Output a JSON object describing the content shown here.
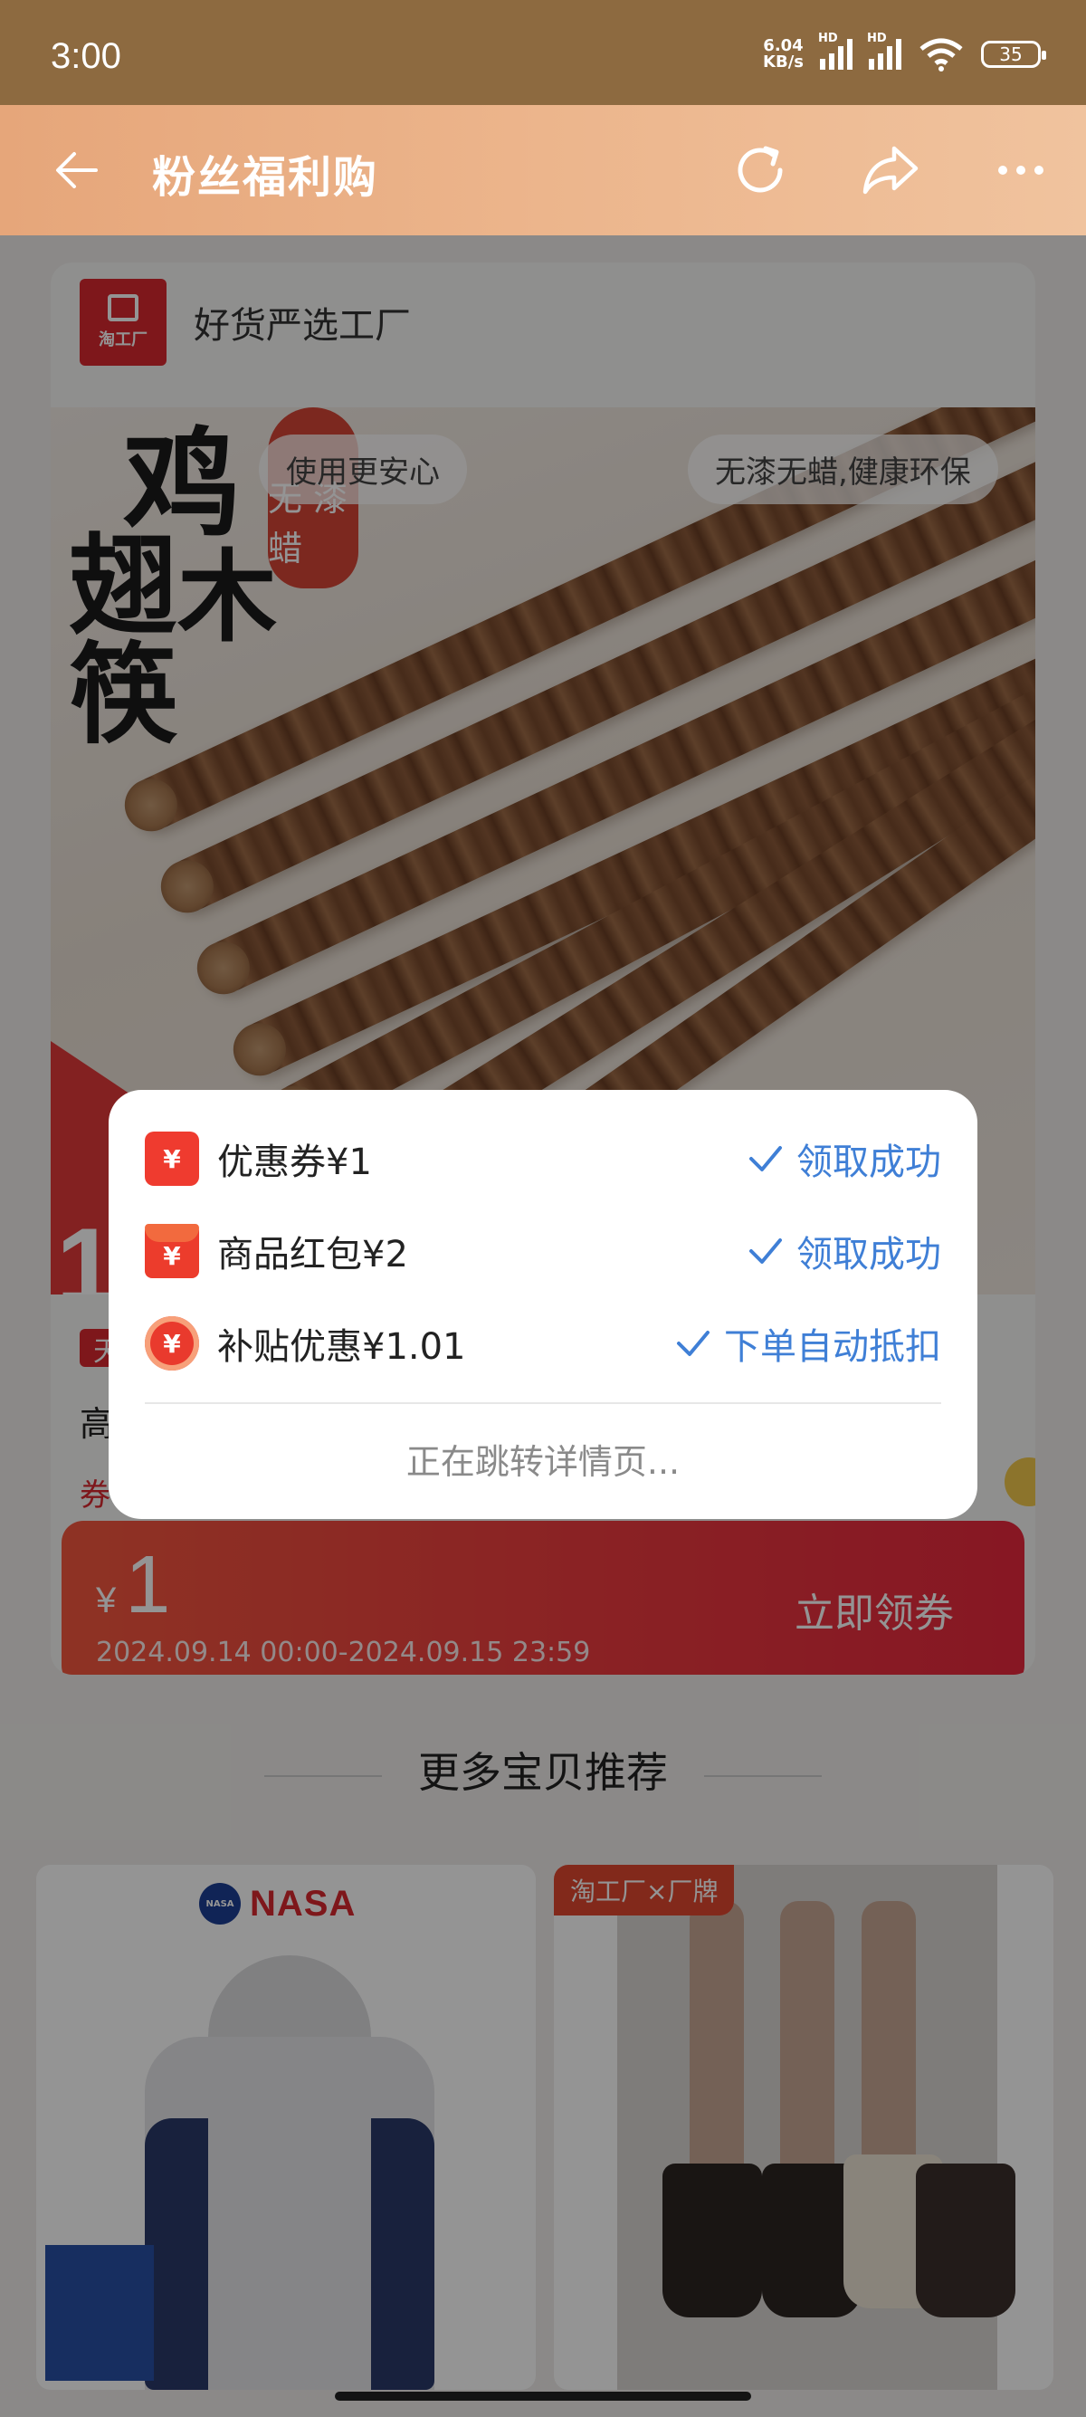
{
  "status_bar": {
    "time": "3:00",
    "net_speed_value": "6.04",
    "net_speed_unit": "KB/s",
    "signal1_label": "HD",
    "signal2_label": "HD",
    "battery": "35"
  },
  "header": {
    "title": "粉丝福利购",
    "icons": [
      "back-arrow-icon",
      "refresh-icon",
      "share-icon",
      "more-icon"
    ]
  },
  "product": {
    "shop_logo_text": "淘工厂",
    "shop_name": "好货严选工厂",
    "image_text": {
      "brand_chars": [
        "鸡",
        "翅",
        "木",
        "筷"
      ],
      "vertical_badge": "无 漆 蜡",
      "pill_left": "使用更安心",
      "pill_right": "无漆无蜡,健康环保",
      "price_partial": "19"
    },
    "tag": "天",
    "title_partial": "高",
    "coupon_label_partial": "券"
  },
  "coupon": {
    "currency": "¥",
    "amount": "1",
    "valid_range": "2024.09.14 00:00-2024.09.15 23:59",
    "action": "立即领券"
  },
  "recommend": {
    "title": "更多宝贝推荐",
    "items": [
      {
        "brand_logo_text": "NASA",
        "brand": "NASA"
      },
      {
        "tag": "淘工厂×厂牌"
      }
    ]
  },
  "dialog": {
    "rows": [
      {
        "icon": "coupon-icon",
        "label": "优惠券¥1",
        "status": "领取成功"
      },
      {
        "icon": "red-packet-icon",
        "label": "商品红包¥2",
        "status": "领取成功"
      },
      {
        "icon": "subsidy-icon",
        "label": "补贴优惠¥1.01",
        "status": "下单自动抵扣"
      }
    ],
    "icon_glyph": "¥",
    "redirect_text": "正在跳转详情页..."
  },
  "colors": {
    "status_bar": "#8d6a40",
    "header_gradient_start": "#e6a67a",
    "accent_red": "#e8283d",
    "link_blue": "#3f7fd6"
  }
}
